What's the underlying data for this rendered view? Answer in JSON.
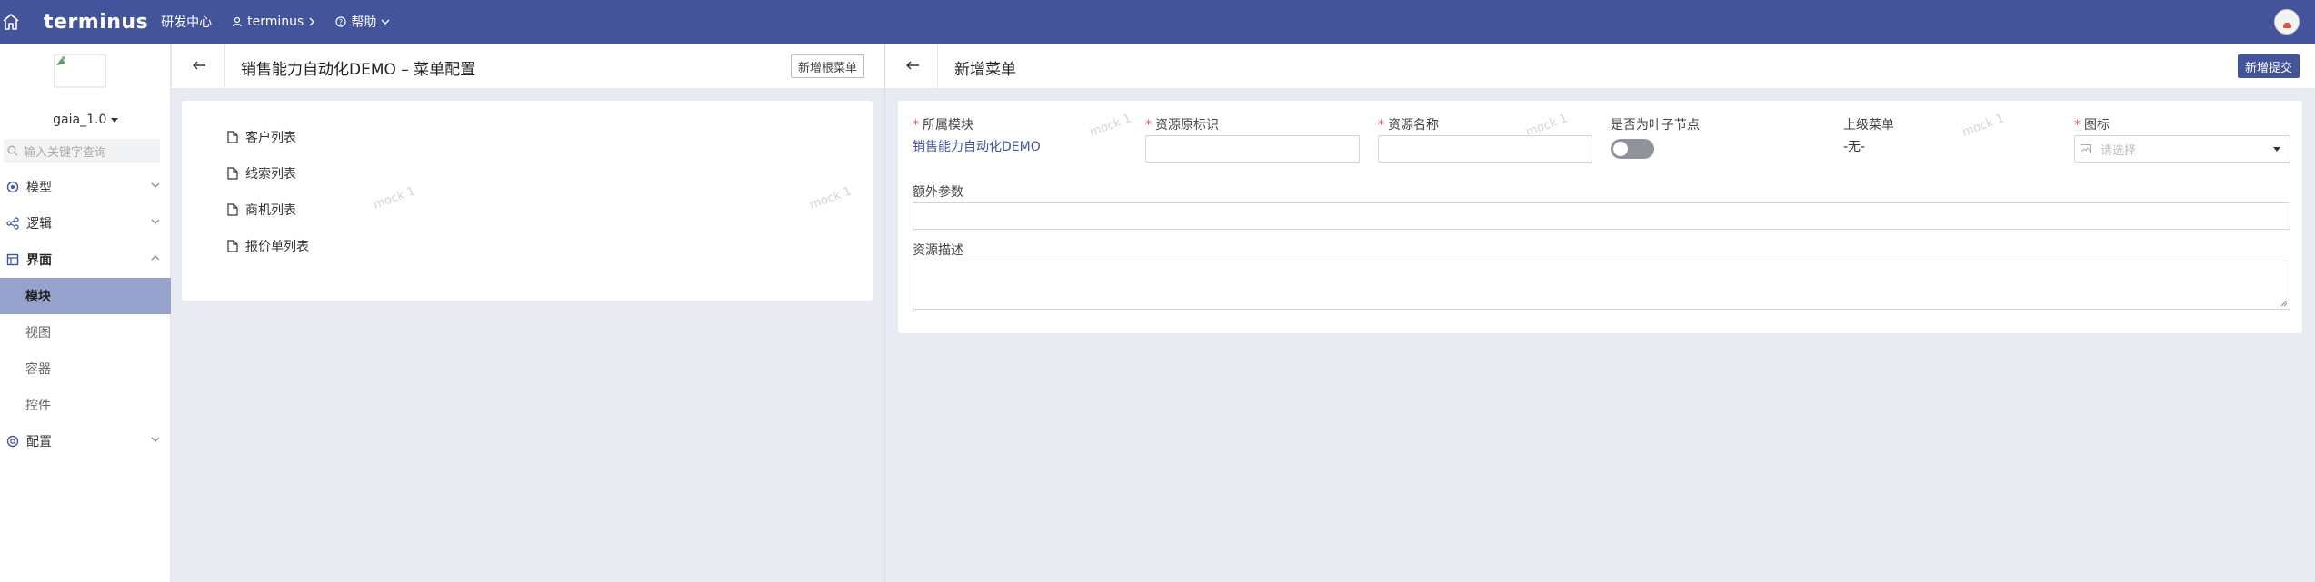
{
  "topbar": {
    "logo": "terminus",
    "nav": [
      {
        "label": "研发中心"
      },
      {
        "label": "terminus"
      },
      {
        "label": "帮助"
      }
    ]
  },
  "sidebar": {
    "version": "gaia_1.0",
    "search_placeholder": "输入关键字查询",
    "groups": [
      {
        "label": "模型",
        "icon": "model-icon"
      },
      {
        "label": "逻辑",
        "icon": "logic-icon"
      },
      {
        "label": "界面",
        "icon": "ui-icon",
        "open": true,
        "items": [
          {
            "label": "模块",
            "active": true
          },
          {
            "label": "视图"
          },
          {
            "label": "容器"
          },
          {
            "label": "控件"
          }
        ]
      },
      {
        "label": "配置",
        "icon": "config-icon"
      }
    ]
  },
  "left_panel": {
    "title": "销售能力自动化DEMO – 菜单配置",
    "add_root_button": "新增根菜单",
    "tree": [
      "客户列表",
      "线索列表",
      "商机列表",
      "报价单列表"
    ]
  },
  "right_panel": {
    "title": "新增菜单",
    "submit_button": "新增提交",
    "fields": {
      "module": {
        "label": "所属模块",
        "required": true,
        "value": "销售能力自动化DEMO"
      },
      "resource_key": {
        "label": "资源原标识",
        "required": true,
        "value": ""
      },
      "resource_name": {
        "label": "资源名称",
        "required": true,
        "value": ""
      },
      "is_leaf": {
        "label": "是否为叶子节点",
        "value": false
      },
      "parent_menu": {
        "label": "上级菜单",
        "value": "-无-"
      },
      "icon": {
        "label": "图标",
        "required": true,
        "placeholder": "请选择"
      },
      "extra_params": {
        "label": "额外参数",
        "value": ""
      },
      "description": {
        "label": "资源描述",
        "value": ""
      }
    }
  },
  "watermark": "mock 1",
  "colors": {
    "brand": "#43549a",
    "active_menu": "#97a2cc",
    "required": "#e5484d"
  }
}
